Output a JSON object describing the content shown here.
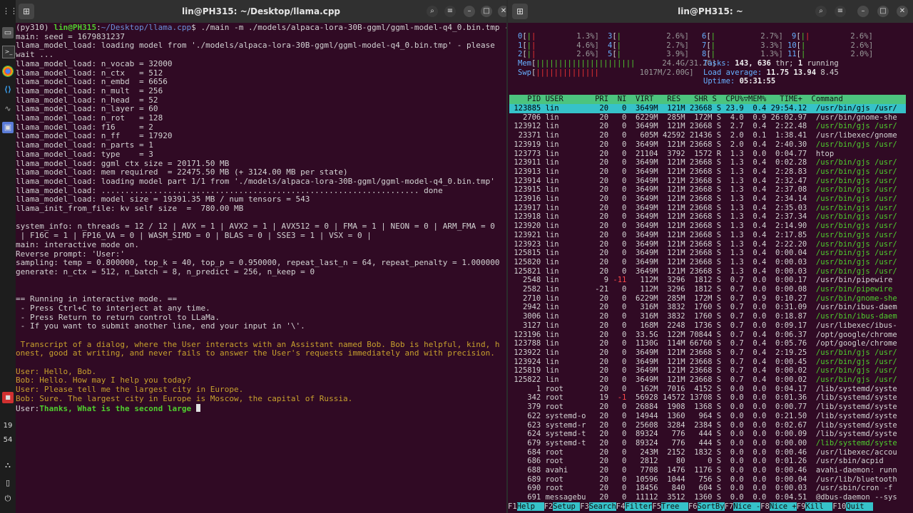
{
  "left_window": {
    "title": "lin@PH315: ~/Desktop/llama.cpp",
    "prompt_user": "lin@PH315",
    "prompt_path": "~/Desktop/llama.cpp",
    "prompt_prefix": "(py310) ",
    "command": "$ ./main -m ./models/alpaca-lora-30B-ggml/ggml-model-q4_0.bin.tmp -n 256 --repeat_penalty 1.0 --color -i -r \"User:\" -f prompts/chat-with-bob.txt --n_parts 1",
    "output_lines": [
      "main: seed = 1679831237",
      "llama_model_load: loading model from './models/alpaca-lora-30B-ggml/ggml-model-q4_0.bin.tmp' - please",
      "wait ...",
      "llama_model_load: n_vocab = 32000",
      "llama_model_load: n_ctx   = 512",
      "llama_model_load: n_embd  = 6656",
      "llama_model_load: n_mult  = 256",
      "llama_model_load: n_head  = 52",
      "llama_model_load: n_layer = 60",
      "llama_model_load: n_rot   = 128",
      "llama_model_load: f16     = 2",
      "llama_model_load: n_ff    = 17920",
      "llama_model_load: n_parts = 1",
      "llama_model_load: type    = 3",
      "llama_model_load: ggml ctx size = 20171.50 MB",
      "llama_model_load: mem required  = 22475.50 MB (+ 3124.00 MB per state)",
      "llama_model_load: loading model part 1/1 from './models/alpaca-lora-30B-ggml/ggml-model-q4_0.bin.tmp'",
      "llama_model_load: ................................................................... done",
      "llama_model_load: model size = 19391.35 MB / num tensors = 543",
      "llama_init_from_file: kv self size  =  780.00 MB",
      "",
      "system_info: n_threads = 12 / 12 | AVX = 1 | AVX2 = 1 | AVX512 = 0 | FMA = 1 | NEON = 0 | ARM_FMA = 0",
      " | F16C = 1 | FP16_VA = 0 | WASM_SIMD = 0 | BLAS = 0 | SSE3 = 1 | VSX = 0 |",
      "main: interactive mode on.",
      "Reverse prompt: 'User:'",
      "sampling: temp = 0.800000, top_k = 40, top_p = 0.950000, repeat_last_n = 64, repeat_penalty = 1.000000",
      "generate: n_ctx = 512, n_batch = 8, n_predict = 256, n_keep = 0",
      "",
      "",
      "== Running in interactive mode. ==",
      " - Press Ctrl+C to interject at any time.",
      " - Press Return to return control to LLaMa.",
      " - If you want to submit another line, end your input in '\\'.",
      ""
    ],
    "transcript_lines": [
      " Transcript of a dialog, where the User interacts with an Assistant named Bob. Bob is helpful, kind, h",
      "onest, good at writing, and never fails to answer the User's requests immediately and with precision.",
      "",
      "User: Hello, Bob.",
      "Bob: Hello. How may I help you today?",
      "User: Please tell me the largest city in Europe.",
      "Bob: Sure. The largest city in Europe is Moscow, the capital of Russia."
    ],
    "input_prefix": "User:",
    "input_text": "Thanks, What is the second large "
  },
  "right_window": {
    "title": "lin@PH315: ~",
    "cpu_meters": [
      {
        "id": "0",
        "bars": "||",
        "pct": "1.3%]"
      },
      {
        "id": "1",
        "bars": "||",
        "pct": "4.6%]"
      },
      {
        "id": "2",
        "bars": "||",
        "pct": "2.6%]"
      },
      {
        "id": "3",
        "bars": "|",
        "pct": "2.6%]"
      },
      {
        "id": "4",
        "bars": "|",
        "pct": "2.7%]"
      },
      {
        "id": "5",
        "bars": "|",
        "pct": "3.9%]"
      },
      {
        "id": "6",
        "bars": "|",
        "pct": "2.7%]"
      },
      {
        "id": "7",
        "bars": "|",
        "pct": "3.3%]"
      },
      {
        "id": "8",
        "bars": "|",
        "pct": "1.3%]"
      },
      {
        "id": "9",
        "bars": "||",
        "pct": "2.6%]"
      },
      {
        "id": "10",
        "bars": "|",
        "pct": "2.6%]"
      },
      {
        "id": "11",
        "bars": "|",
        "pct": "2.0%]"
      }
    ],
    "mem_label": "Mem",
    "mem_bar": "||||||||||||||||||||||",
    "mem_value": "24.4G/31.2G]",
    "swp_label": "Swp",
    "swp_bar": "||||||||||||||",
    "swp_value": "1017M/2.00G]",
    "tasks_label": "Tasks:",
    "tasks_value": "143,",
    "thr_value": "636",
    "thr_label": "thr;",
    "running_value": "1",
    "running_label": "running",
    "load_label": "Load average:",
    "load_1": "11.75",
    "load_5": "13.94",
    "load_15": "8.45",
    "uptime_label": "Uptime:",
    "uptime_value": "05:31:55",
    "header": "    PID USER       PRI  NI  VIRT   RES   SHR S  CPU%▽MEM%   TIME+  Command",
    "processes": [
      {
        "pid": "123885",
        "user": "lin",
        "pri": "20",
        "ni": "0",
        "virt": "3649M",
        "res": "121M",
        "shr": "23668",
        "s": "S",
        "cpu": "23.9",
        "mem": "0.4",
        "time": "29:54.12",
        "cmd": "/usr/bin/gjs /usr/",
        "sel": true,
        "cc": "green"
      },
      {
        "pid": "2706",
        "user": "lin",
        "pri": "20",
        "ni": "0",
        "virt": "6229M",
        "res": "285M",
        "shr": "172M",
        "s": "S",
        "cpu": "4.0",
        "mem": "0.9",
        "time": "26:02.97",
        "cmd": "/usr/bin/gnome-she",
        "cc": ""
      },
      {
        "pid": "123912",
        "user": "lin",
        "pri": "20",
        "ni": "0",
        "virt": "3649M",
        "res": "121M",
        "shr": "23668",
        "s": "S",
        "cpu": "2.7",
        "mem": "0.4",
        "time": "2:22.48",
        "cmd": "/usr/bin/gjs /usr/",
        "cc": "green"
      },
      {
        "pid": "23371",
        "user": "lin",
        "pri": "20",
        "ni": "0",
        "virt": "605M",
        "res": "42592",
        "shr": "21436",
        "s": "S",
        "cpu": "2.0",
        "mem": "0.1",
        "time": "1:38.41",
        "cmd": "/usr/libexec/gnome",
        "cc": ""
      },
      {
        "pid": "123919",
        "user": "lin",
        "pri": "20",
        "ni": "0",
        "virt": "3649M",
        "res": "121M",
        "shr": "23668",
        "s": "S",
        "cpu": "2.0",
        "mem": "0.4",
        "time": "2:40.30",
        "cmd": "/usr/bin/gjs /usr/",
        "cc": "green"
      },
      {
        "pid": "123773",
        "user": "lin",
        "pri": "20",
        "ni": "0",
        "virt": "21104",
        "res": "3792",
        "shr": "1572",
        "s": "R",
        "cpu": "1.3",
        "mem": "0.0",
        "time": "0:04.77",
        "cmd": "htop",
        "cc": ""
      },
      {
        "pid": "123911",
        "user": "lin",
        "pri": "20",
        "ni": "0",
        "virt": "3649M",
        "res": "121M",
        "shr": "23668",
        "s": "S",
        "cpu": "1.3",
        "mem": "0.4",
        "time": "0:02.28",
        "cmd": "/usr/bin/gjs /usr/",
        "cc": "green"
      },
      {
        "pid": "123913",
        "user": "lin",
        "pri": "20",
        "ni": "0",
        "virt": "3649M",
        "res": "121M",
        "shr": "23668",
        "s": "S",
        "cpu": "1.3",
        "mem": "0.4",
        "time": "2:28.83",
        "cmd": "/usr/bin/gjs /usr/",
        "cc": "green"
      },
      {
        "pid": "123914",
        "user": "lin",
        "pri": "20",
        "ni": "0",
        "virt": "3649M",
        "res": "121M",
        "shr": "23668",
        "s": "S",
        "cpu": "1.3",
        "mem": "0.4",
        "time": "2:32.47",
        "cmd": "/usr/bin/gjs /usr/",
        "cc": "green"
      },
      {
        "pid": "123915",
        "user": "lin",
        "pri": "20",
        "ni": "0",
        "virt": "3649M",
        "res": "121M",
        "shr": "23668",
        "s": "S",
        "cpu": "1.3",
        "mem": "0.4",
        "time": "2:37.08",
        "cmd": "/usr/bin/gjs /usr/",
        "cc": "green"
      },
      {
        "pid": "123916",
        "user": "lin",
        "pri": "20",
        "ni": "0",
        "virt": "3649M",
        "res": "121M",
        "shr": "23668",
        "s": "S",
        "cpu": "1.3",
        "mem": "0.4",
        "time": "2:34.14",
        "cmd": "/usr/bin/gjs /usr/",
        "cc": "green"
      },
      {
        "pid": "123917",
        "user": "lin",
        "pri": "20",
        "ni": "0",
        "virt": "3649M",
        "res": "121M",
        "shr": "23668",
        "s": "S",
        "cpu": "1.3",
        "mem": "0.4",
        "time": "2:35.03",
        "cmd": "/usr/bin/gjs /usr/",
        "cc": "green"
      },
      {
        "pid": "123918",
        "user": "lin",
        "pri": "20",
        "ni": "0",
        "virt": "3649M",
        "res": "121M",
        "shr": "23668",
        "s": "S",
        "cpu": "1.3",
        "mem": "0.4",
        "time": "2:37.34",
        "cmd": "/usr/bin/gjs /usr/",
        "cc": "green"
      },
      {
        "pid": "123920",
        "user": "lin",
        "pri": "20",
        "ni": "0",
        "virt": "3649M",
        "res": "121M",
        "shr": "23668",
        "s": "S",
        "cpu": "1.3",
        "mem": "0.4",
        "time": "2:14.90",
        "cmd": "/usr/bin/gjs /usr/",
        "cc": "green"
      },
      {
        "pid": "123921",
        "user": "lin",
        "pri": "20",
        "ni": "0",
        "virt": "3649M",
        "res": "121M",
        "shr": "23668",
        "s": "S",
        "cpu": "1.3",
        "mem": "0.4",
        "time": "2:17.85",
        "cmd": "/usr/bin/gjs /usr/",
        "cc": "green"
      },
      {
        "pid": "123923",
        "user": "lin",
        "pri": "20",
        "ni": "0",
        "virt": "3649M",
        "res": "121M",
        "shr": "23668",
        "s": "S",
        "cpu": "1.3",
        "mem": "0.4",
        "time": "2:22.20",
        "cmd": "/usr/bin/gjs /usr/",
        "cc": "green"
      },
      {
        "pid": "125815",
        "user": "lin",
        "pri": "20",
        "ni": "0",
        "virt": "3649M",
        "res": "121M",
        "shr": "23668",
        "s": "S",
        "cpu": "1.3",
        "mem": "0.4",
        "time": "0:00.04",
        "cmd": "/usr/bin/gjs /usr/",
        "cc": "green"
      },
      {
        "pid": "125820",
        "user": "lin",
        "pri": "20",
        "ni": "0",
        "virt": "3649M",
        "res": "121M",
        "shr": "23668",
        "s": "S",
        "cpu": "1.3",
        "mem": "0.4",
        "time": "0:00.03",
        "cmd": "/usr/bin/gjs /usr/",
        "cc": "green"
      },
      {
        "pid": "125821",
        "user": "lin",
        "pri": "20",
        "ni": "0",
        "virt": "3649M",
        "res": "121M",
        "shr": "23668",
        "s": "S",
        "cpu": "1.3",
        "mem": "0.4",
        "time": "0:00.03",
        "cmd": "/usr/bin/gjs /usr/",
        "cc": "green"
      },
      {
        "pid": "2548",
        "user": "lin",
        "pri": "9",
        "ni": "-11",
        "virt": "112M",
        "res": "3296",
        "shr": "1812",
        "s": "S",
        "cpu": "0.7",
        "mem": "0.0",
        "time": "0:00.17",
        "cmd": "/usr/bin/pipewire",
        "cc": ""
      },
      {
        "pid": "2582",
        "user": "lin",
        "pri": "-21",
        "ni": "0",
        "virt": "112M",
        "res": "3296",
        "shr": "1812",
        "s": "S",
        "cpu": "0.7",
        "mem": "0.0",
        "time": "0:00.08",
        "cmd": "/usr/bin/pipewire",
        "cc": "green"
      },
      {
        "pid": "2710",
        "user": "lin",
        "pri": "20",
        "ni": "0",
        "virt": "6229M",
        "res": "285M",
        "shr": "172M",
        "s": "S",
        "cpu": "0.7",
        "mem": "0.9",
        "time": "0:10.27",
        "cmd": "/usr/bin/gnome-she",
        "cc": "green"
      },
      {
        "pid": "2942",
        "user": "lin",
        "pri": "20",
        "ni": "0",
        "virt": "316M",
        "res": "3832",
        "shr": "1760",
        "s": "S",
        "cpu": "0.7",
        "mem": "0.0",
        "time": "0:31.09",
        "cmd": "/usr/bin/ibus-daem",
        "cc": ""
      },
      {
        "pid": "3006",
        "user": "lin",
        "pri": "20",
        "ni": "0",
        "virt": "316M",
        "res": "3832",
        "shr": "1760",
        "s": "S",
        "cpu": "0.7",
        "mem": "0.0",
        "time": "0:18.87",
        "cmd": "/usr/bin/ibus-daem",
        "cc": "green"
      },
      {
        "pid": "3127",
        "user": "lin",
        "pri": "20",
        "ni": "0",
        "virt": "168M",
        "res": "2248",
        "shr": "1736",
        "s": "S",
        "cpu": "0.7",
        "mem": "0.0",
        "time": "0:09.17",
        "cmd": "/usr/libexec/ibus-",
        "cc": ""
      },
      {
        "pid": "123196",
        "user": "lin",
        "pri": "20",
        "ni": "0",
        "virt": "33.5G",
        "res": "122M",
        "shr": "70844",
        "s": "S",
        "cpu": "0.7",
        "mem": "0.4",
        "time": "0:06.37",
        "cmd": "/opt/google/chrome",
        "cc": ""
      },
      {
        "pid": "123788",
        "user": "lin",
        "pri": "20",
        "ni": "0",
        "virt": "1130G",
        "res": "114M",
        "shr": "66760",
        "s": "S",
        "cpu": "0.7",
        "mem": "0.4",
        "time": "0:05.76",
        "cmd": "/opt/google/chrome",
        "cc": ""
      },
      {
        "pid": "123922",
        "user": "lin",
        "pri": "20",
        "ni": "0",
        "virt": "3649M",
        "res": "121M",
        "shr": "23668",
        "s": "S",
        "cpu": "0.7",
        "mem": "0.4",
        "time": "2:19.25",
        "cmd": "/usr/bin/gjs /usr/",
        "cc": "green"
      },
      {
        "pid": "123924",
        "user": "lin",
        "pri": "20",
        "ni": "0",
        "virt": "3649M",
        "res": "121M",
        "shr": "23668",
        "s": "S",
        "cpu": "0.7",
        "mem": "0.4",
        "time": "0:00.45",
        "cmd": "/usr/bin/gjs /usr/",
        "cc": "green"
      },
      {
        "pid": "125819",
        "user": "lin",
        "pri": "20",
        "ni": "0",
        "virt": "3649M",
        "res": "121M",
        "shr": "23668",
        "s": "S",
        "cpu": "0.7",
        "mem": "0.4",
        "time": "0:00.02",
        "cmd": "/usr/bin/gjs /usr/",
        "cc": "green"
      },
      {
        "pid": "125822",
        "user": "lin",
        "pri": "20",
        "ni": "0",
        "virt": "3649M",
        "res": "121M",
        "shr": "23668",
        "s": "S",
        "cpu": "0.7",
        "mem": "0.4",
        "time": "0:00.02",
        "cmd": "/usr/bin/gjs /usr/",
        "cc": "green"
      },
      {
        "pid": "1",
        "user": "root",
        "pri": "20",
        "ni": "0",
        "virt": "162M",
        "res": "7016",
        "shr": "4152",
        "s": "S",
        "cpu": "0.0",
        "mem": "0.0",
        "time": "0:04.17",
        "cmd": "/lib/systemd/syste",
        "cc": ""
      },
      {
        "pid": "342",
        "user": "root",
        "pri": "19",
        "ni": "-1",
        "virt": "56928",
        "res": "14572",
        "shr": "13708",
        "s": "S",
        "cpu": "0.0",
        "mem": "0.0",
        "time": "0:01.36",
        "cmd": "/lib/systemd/syste",
        "cc": ""
      },
      {
        "pid": "379",
        "user": "root",
        "pri": "20",
        "ni": "0",
        "virt": "26884",
        "res": "1908",
        "shr": "1368",
        "s": "S",
        "cpu": "0.0",
        "mem": "0.0",
        "time": "0:00.77",
        "cmd": "/lib/systemd/syste",
        "cc": ""
      },
      {
        "pid": "622",
        "user": "systemd-o",
        "pri": "20",
        "ni": "0",
        "virt": "14944",
        "res": "1360",
        "shr": "964",
        "s": "S",
        "cpu": "0.0",
        "mem": "0.0",
        "time": "0:21.50",
        "cmd": "/lib/systemd/syste",
        "cc": ""
      },
      {
        "pid": "623",
        "user": "systemd-r",
        "pri": "20",
        "ni": "0",
        "virt": "25608",
        "res": "3284",
        "shr": "2384",
        "s": "S",
        "cpu": "0.0",
        "mem": "0.0",
        "time": "0:02.67",
        "cmd": "/lib/systemd/syste",
        "cc": ""
      },
      {
        "pid": "624",
        "user": "systemd-t",
        "pri": "20",
        "ni": "0",
        "virt": "89324",
        "res": "776",
        "shr": "444",
        "s": "S",
        "cpu": "0.0",
        "mem": "0.0",
        "time": "0:00.09",
        "cmd": "/lib/systemd/syste",
        "cc": ""
      },
      {
        "pid": "679",
        "user": "systemd-t",
        "pri": "20",
        "ni": "0",
        "virt": "89324",
        "res": "776",
        "shr": "444",
        "s": "S",
        "cpu": "0.0",
        "mem": "0.0",
        "time": "0:00.00",
        "cmd": "/lib/systemd/syste",
        "cc": "green"
      },
      {
        "pid": "684",
        "user": "root",
        "pri": "20",
        "ni": "0",
        "virt": "243M",
        "res": "2152",
        "shr": "1832",
        "s": "S",
        "cpu": "0.0",
        "mem": "0.0",
        "time": "0:00.46",
        "cmd": "/usr/libexec/accou",
        "cc": ""
      },
      {
        "pid": "686",
        "user": "root",
        "pri": "20",
        "ni": "0",
        "virt": "2812",
        "res": "80",
        "shr": "0",
        "s": "S",
        "cpu": "0.0",
        "mem": "0.0",
        "time": "0:01.26",
        "cmd": "/usr/sbin/acpid",
        "cc": ""
      },
      {
        "pid": "688",
        "user": "avahi",
        "pri": "20",
        "ni": "0",
        "virt": "7708",
        "res": "1476",
        "shr": "1176",
        "s": "S",
        "cpu": "0.0",
        "mem": "0.0",
        "time": "0:00.46",
        "cmd": "avahi-daemon: runn",
        "cc": ""
      },
      {
        "pid": "689",
        "user": "root",
        "pri": "20",
        "ni": "0",
        "virt": "10596",
        "res": "1044",
        "shr": "756",
        "s": "S",
        "cpu": "0.0",
        "mem": "0.0",
        "time": "0:00.04",
        "cmd": "/usr/lib/bluetooth",
        "cc": ""
      },
      {
        "pid": "690",
        "user": "root",
        "pri": "20",
        "ni": "0",
        "virt": "18456",
        "res": "840",
        "shr": "604",
        "s": "S",
        "cpu": "0.0",
        "mem": "0.0",
        "time": "0:00.03",
        "cmd": "/usr/sbin/cron -f",
        "cc": ""
      },
      {
        "pid": "691",
        "user": "messagebu",
        "pri": "20",
        "ni": "0",
        "virt": "11112",
        "res": "3512",
        "shr": "1360",
        "s": "S",
        "cpu": "0.0",
        "mem": "0.0",
        "time": "0:04.51",
        "cmd": "@dbus-daemon --sys",
        "cc": ""
      }
    ],
    "fkeys": [
      {
        "k": "F1",
        "l": "Help  "
      },
      {
        "k": "F2",
        "l": "Setup "
      },
      {
        "k": "F3",
        "l": "Search"
      },
      {
        "k": "F4",
        "l": "Filter"
      },
      {
        "k": "F5",
        "l": "Tree  "
      },
      {
        "k": "F6",
        "l": "SortBy"
      },
      {
        "k": "F7",
        "l": "Nice -"
      },
      {
        "k": "F8",
        "l": "Nice +"
      },
      {
        "k": "F9",
        "l": "Kill  "
      },
      {
        "k": "F10",
        "l": "Quit  "
      }
    ]
  },
  "dock": {
    "clock_hour": "19",
    "clock_min": "54"
  }
}
